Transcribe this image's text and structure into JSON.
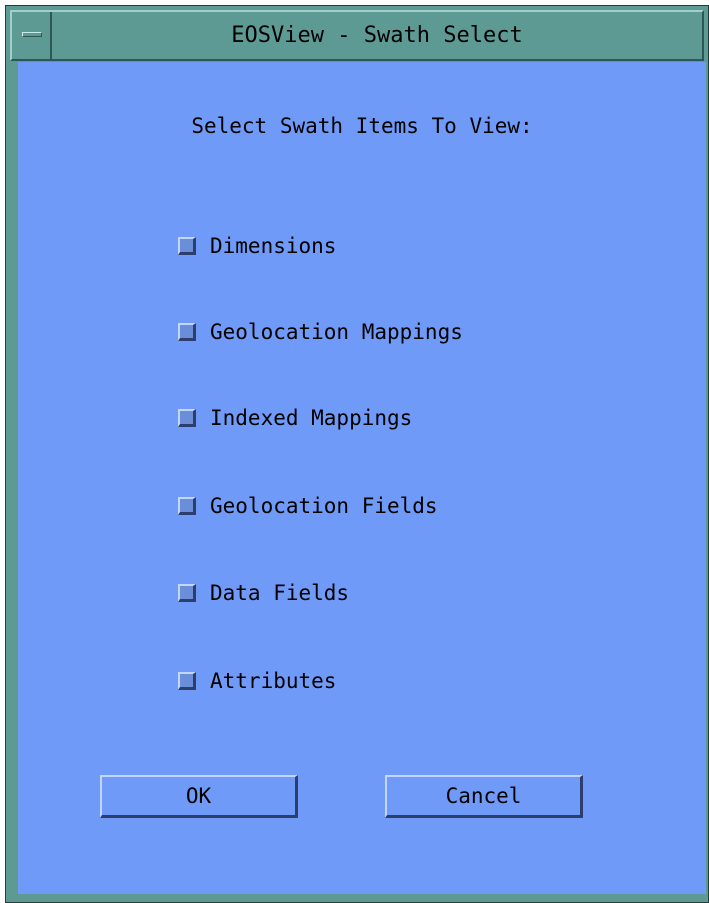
{
  "window": {
    "title": "EOSView - Swath Select"
  },
  "dialog": {
    "heading": "Select Swath Items To View:",
    "items": [
      {
        "label": "Dimensions",
        "checked": false
      },
      {
        "label": "Geolocation Mappings",
        "checked": false
      },
      {
        "label": "Indexed Mappings",
        "checked": false
      },
      {
        "label": "Geolocation Fields",
        "checked": false
      },
      {
        "label": "Data Fields",
        "checked": false
      },
      {
        "label": "Attributes",
        "checked": false
      }
    ],
    "ok_label": "OK",
    "cancel_label": "Cancel"
  },
  "colors": {
    "frame": "#5e9a94",
    "client": "#6f9af8"
  },
  "icons": {
    "window_menu": "window-menu-icon",
    "checkbox": "checkbox-toggle"
  }
}
